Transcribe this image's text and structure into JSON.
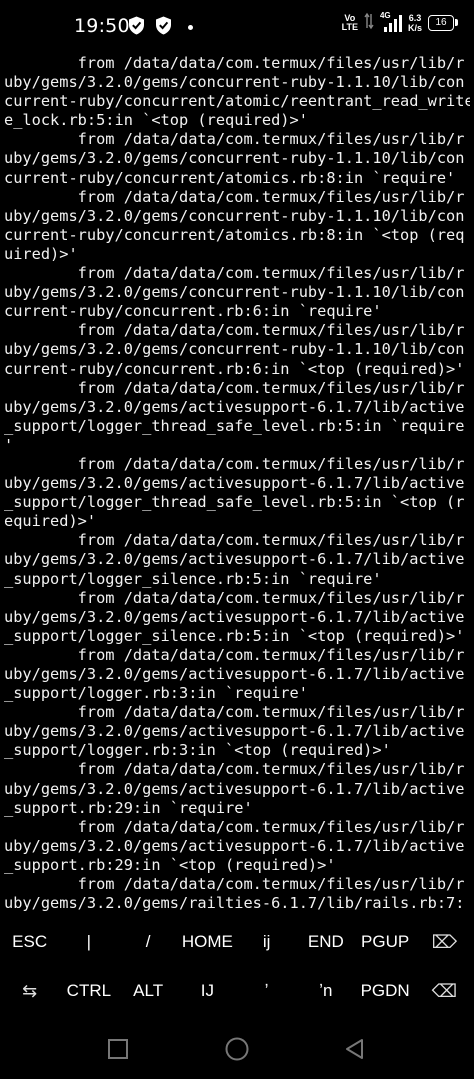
{
  "status_bar": {
    "time": "19:50",
    "volte_top": "Vo",
    "volte_bottom": "LTE",
    "network_type": "4G",
    "speed_value": "6.3",
    "speed_unit": "K/s",
    "battery": "16"
  },
  "terminal": {
    "lines": [
      "        from /data/data/com.termux/files/usr/lib/r",
      "uby/gems/3.2.0/gems/concurrent-ruby-1.1.10/lib/con",
      "current-ruby/concurrent/atomic/reentrant_read_write",
      "e_lock.rb:5:in `<top (required)>'",
      "        from /data/data/com.termux/files/usr/lib/r",
      "uby/gems/3.2.0/gems/concurrent-ruby-1.1.10/lib/con",
      "current-ruby/concurrent/atomics.rb:8:in `require'",
      "        from /data/data/com.termux/files/usr/lib/r",
      "uby/gems/3.2.0/gems/concurrent-ruby-1.1.10/lib/con",
      "current-ruby/concurrent/atomics.rb:8:in `<top (req",
      "uired)>'",
      "        from /data/data/com.termux/files/usr/lib/r",
      "uby/gems/3.2.0/gems/concurrent-ruby-1.1.10/lib/con",
      "current-ruby/concurrent.rb:6:in `require'",
      "        from /data/data/com.termux/files/usr/lib/r",
      "uby/gems/3.2.0/gems/concurrent-ruby-1.1.10/lib/con",
      "current-ruby/concurrent.rb:6:in `<top (required)>'",
      "        from /data/data/com.termux/files/usr/lib/r",
      "uby/gems/3.2.0/gems/activesupport-6.1.7/lib/active",
      "_support/logger_thread_safe_level.rb:5:in `require",
      "'",
      "        from /data/data/com.termux/files/usr/lib/r",
      "uby/gems/3.2.0/gems/activesupport-6.1.7/lib/active",
      "_support/logger_thread_safe_level.rb:5:in `<top (r",
      "equired)>'",
      "        from /data/data/com.termux/files/usr/lib/r",
      "uby/gems/3.2.0/gems/activesupport-6.1.7/lib/active",
      "_support/logger_silence.rb:5:in `require'",
      "        from /data/data/com.termux/files/usr/lib/r",
      "uby/gems/3.2.0/gems/activesupport-6.1.7/lib/active",
      "_support/logger_silence.rb:5:in `<top (required)>'",
      "        from /data/data/com.termux/files/usr/lib/r",
      "uby/gems/3.2.0/gems/activesupport-6.1.7/lib/active",
      "_support/logger.rb:3:in `require'",
      "        from /data/data/com.termux/files/usr/lib/r",
      "uby/gems/3.2.0/gems/activesupport-6.1.7/lib/active",
      "_support/logger.rb:3:in `<top (required)>'",
      "        from /data/data/com.termux/files/usr/lib/r",
      "uby/gems/3.2.0/gems/activesupport-6.1.7/lib/active",
      "_support.rb:29:in `require'",
      "        from /data/data/com.termux/files/usr/lib/r",
      "uby/gems/3.2.0/gems/activesupport-6.1.7/lib/active",
      "_support.rb:29:in `<top (required)>'",
      "        from /data/data/com.termux/files/usr/lib/r",
      "uby/gems/3.2.0/gems/railties-6.1.7/lib/rails.rb:7:"
    ]
  },
  "extra_keys": {
    "row1": [
      {
        "label": "ESC",
        "name": "esc-key"
      },
      {
        "label": "|",
        "name": "pipe-key"
      },
      {
        "label": "/",
        "name": "slash-key"
      },
      {
        "label": "HOME",
        "name": "home-key"
      },
      {
        "label": "ij",
        "name": "ij-key"
      },
      {
        "label": "END",
        "name": "end-key"
      },
      {
        "label": "PGUP",
        "name": "pgup-key"
      },
      {
        "label": "⌦",
        "name": "forward-delete-key",
        "icon": "forward-delete-icon"
      }
    ],
    "row2": [
      {
        "label": "⇆",
        "name": "tab-key",
        "icon": "tab-arrows-icon"
      },
      {
        "label": "CTRL",
        "name": "ctrl-key"
      },
      {
        "label": "ALT",
        "name": "alt-key"
      },
      {
        "label": "IJ",
        "name": "IJ-key"
      },
      {
        "label": "ʼ",
        "name": "apostrophe-key"
      },
      {
        "label": "ʼn",
        "name": "n-apostrophe-key"
      },
      {
        "label": "PGDN",
        "name": "pgdn-key"
      },
      {
        "label": "⌫",
        "name": "backspace-key",
        "icon": "backspace-icon"
      }
    ]
  },
  "nav_bar": {
    "icons": [
      "recents-square-icon",
      "home-circle-icon",
      "back-triangle-icon"
    ]
  }
}
